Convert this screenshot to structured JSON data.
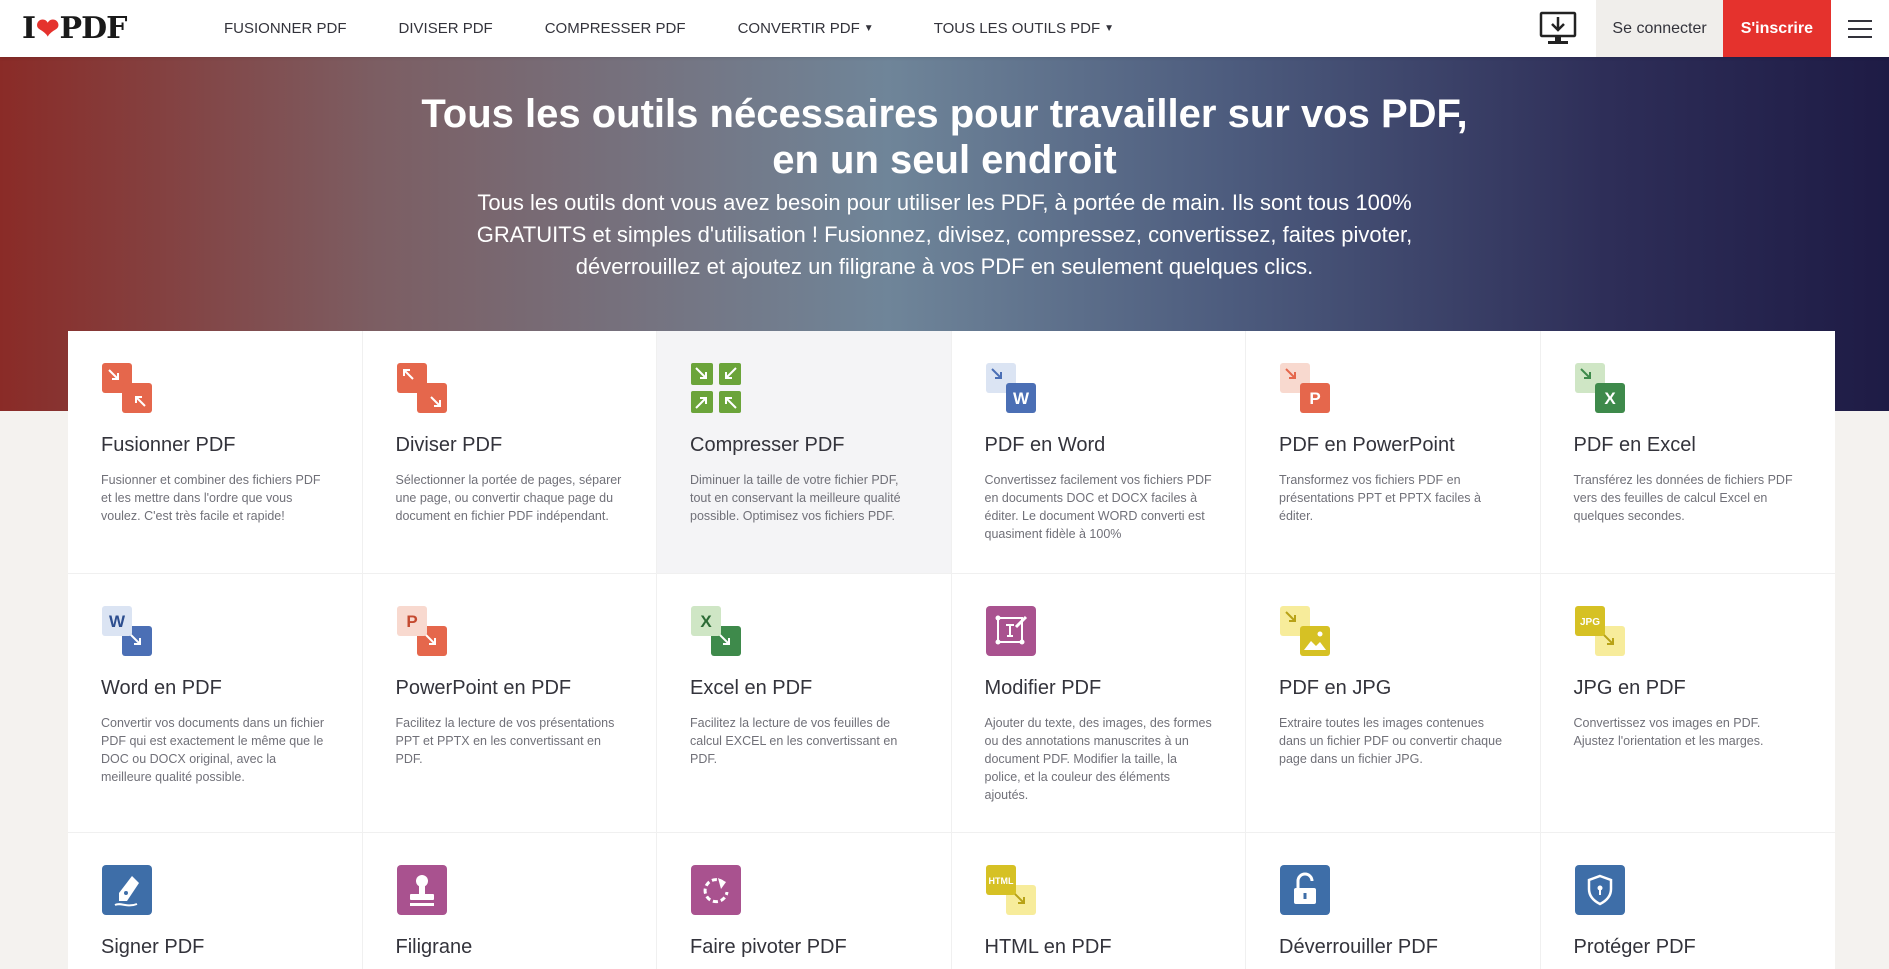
{
  "header": {
    "logo": {
      "before": "I",
      "after": "PDF"
    },
    "nav": [
      {
        "label": "FUSIONNER PDF",
        "dropdown": false
      },
      {
        "label": "DIVISER PDF",
        "dropdown": false
      },
      {
        "label": "COMPRESSER PDF",
        "dropdown": false
      },
      {
        "label": "CONVERTIR PDF",
        "dropdown": true
      },
      {
        "label": "TOUS LES OUTILS PDF",
        "dropdown": true
      }
    ],
    "login_label": "Se connecter",
    "signup_label": "S'inscrire"
  },
  "hero": {
    "title_line1": "Tous les outils nécessaires pour travailler sur vos PDF,",
    "title_line2": "en un seul endroit",
    "subtitle": "Tous les outils dont vous avez besoin pour utiliser les PDF, à portée de main. Ils sont tous 100% GRATUITS et simples d'utilisation ! Fusionnez, divisez, compressez, convertissez, faites pivoter, déverrouillez et ajoutez un filigrane à vos PDF en seulement quelques clics."
  },
  "tools": [
    {
      "title": "Fusionner PDF",
      "desc": "Fusionner et combiner des fichiers PDF et les mettre dans l'ordre que vous voulez. C'est très facile et rapide!",
      "icon": "merge-icon"
    },
    {
      "title": "Diviser PDF",
      "desc": "Sélectionner la portée de pages, séparer une page, ou convertir chaque page du document en fichier PDF indépendant.",
      "icon": "split-icon"
    },
    {
      "title": "Compresser PDF",
      "desc": "Diminuer la taille de votre fichier PDF, tout en conservant la meilleure qualité possible. Optimisez vos fichiers PDF.",
      "icon": "compress-icon"
    },
    {
      "title": "PDF en Word",
      "desc": "Convertissez facilement vos fichiers PDF en documents DOC et DOCX faciles à éditer. Le document WORD converti est quasiment fidèle à 100%",
      "icon": "pdf-to-word-icon",
      "letter": "W"
    },
    {
      "title": "PDF en PowerPoint",
      "desc": "Transformez vos fichiers PDF en présentations PPT et PPTX faciles à éditer.",
      "icon": "pdf-to-powerpoint-icon",
      "letter": "P"
    },
    {
      "title": "PDF en Excel",
      "desc": "Transférez les données de fichiers PDF vers des feuilles de calcul Excel en quelques secondes.",
      "icon": "pdf-to-excel-icon",
      "letter": "X"
    },
    {
      "title": "Word en PDF",
      "desc": "Convertir vos documents dans un fichier PDF qui est exactement le même que le DOC ou DOCX original, avec la meilleure qualité possible.",
      "icon": "word-to-pdf-icon",
      "letter": "W"
    },
    {
      "title": "PowerPoint en PDF",
      "desc": "Facilitez la lecture de vos présentations PPT et PPTX en les convertissant en PDF.",
      "icon": "powerpoint-to-pdf-icon",
      "letter": "P"
    },
    {
      "title": "Excel en PDF",
      "desc": "Facilitez la lecture de vos feuilles de calcul EXCEL en les convertissant en PDF.",
      "icon": "excel-to-pdf-icon",
      "letter": "X"
    },
    {
      "title": "Modifier PDF",
      "desc": "Ajouter du texte, des images, des formes ou des annotations manuscrites à un document PDF. Modifier la taille, la police, et la couleur des éléments ajoutés.",
      "icon": "edit-pdf-icon"
    },
    {
      "title": "PDF en JPG",
      "desc": "Extraire toutes les images contenues dans un fichier PDF ou convertir chaque page dans un fichier JPG.",
      "icon": "pdf-to-jpg-icon"
    },
    {
      "title": "JPG en PDF",
      "desc": "Convertissez vos images en PDF. Ajustez l'orientation et les marges.",
      "icon": "jpg-to-pdf-icon",
      "letter": "JPG"
    },
    {
      "title": "Signer PDF",
      "desc": "",
      "icon": "sign-pdf-icon"
    },
    {
      "title": "Filigrane",
      "desc": "",
      "icon": "watermark-icon"
    },
    {
      "title": "Faire pivoter PDF",
      "desc": "",
      "icon": "rotate-pdf-icon"
    },
    {
      "title": "HTML en PDF",
      "desc": "",
      "icon": "html-to-pdf-icon",
      "letter": "HTML"
    },
    {
      "title": "Déverrouiller PDF",
      "desc": "",
      "icon": "unlock-pdf-icon"
    },
    {
      "title": "Protéger PDF",
      "desc": "",
      "icon": "protect-pdf-icon"
    }
  ]
}
